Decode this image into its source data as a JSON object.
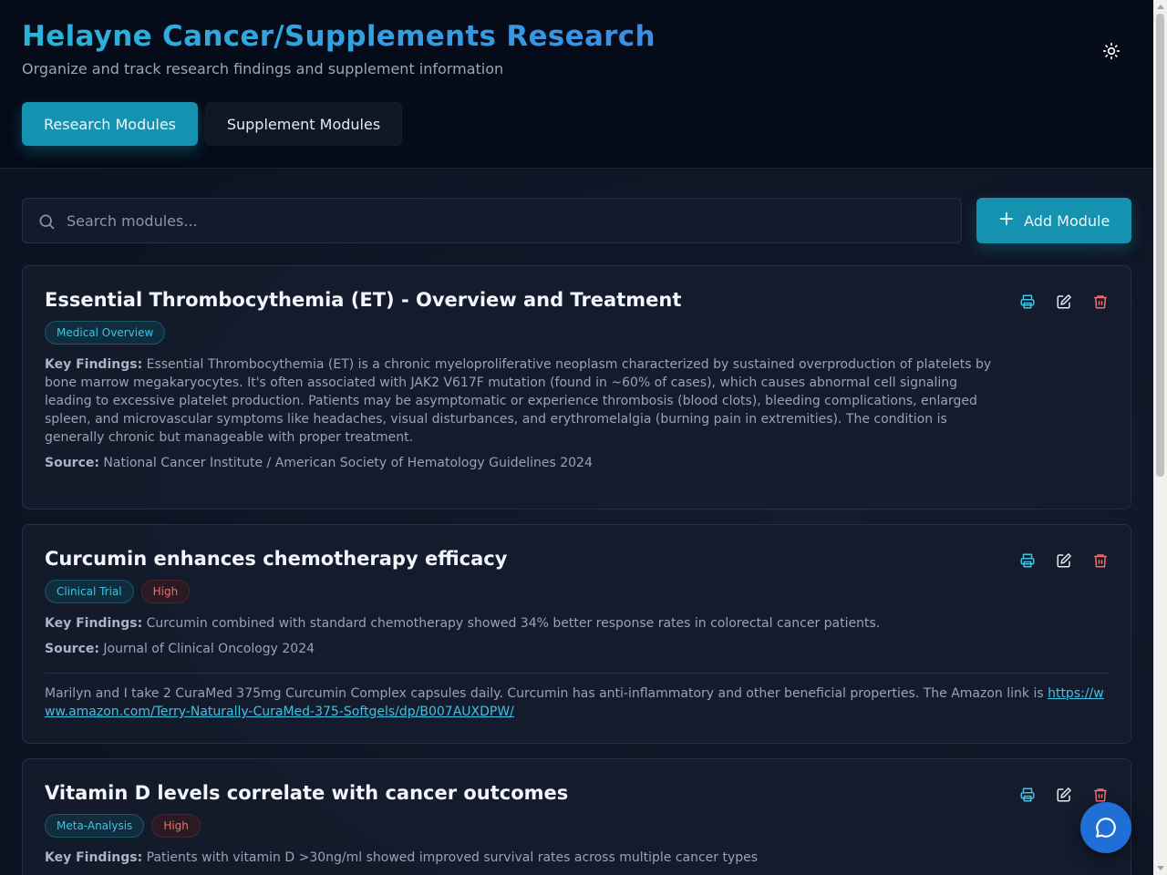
{
  "header": {
    "title": "Helayne Cancer/Supplements Research",
    "subtitle": "Organize and track research findings and supplement information",
    "theme_toggle_icon": "sun-icon"
  },
  "tabs": [
    {
      "label": "Research Modules",
      "active": true
    },
    {
      "label": "Supplement Modules",
      "active": false
    }
  ],
  "search": {
    "placeholder": "Search modules...",
    "value": ""
  },
  "add_button": {
    "label": "Add Module",
    "icon": "plus-icon"
  },
  "labels": {
    "key_findings": "Key Findings:",
    "source": "Source:"
  },
  "modules": [
    {
      "title": "Essential Thrombocythemia (ET) - Overview and Treatment",
      "category": "Medical Overview",
      "priority": null,
      "key_findings": "Essential Thrombocythemia (ET) is a chronic myeloproliferative neoplasm characterized by sustained overproduction of platelets by bone marrow megakaryocytes. It's often associated with JAK2 V617F mutation (found in ~60% of cases), which causes abnormal cell signaling leading to excessive platelet production. Patients may be asymptomatic or experience thrombosis (blood clots), bleeding complications, enlarged spleen, and microvascular symptoms like headaches, visual disturbances, and erythromelalgia (burning pain in extremities). The condition is generally chronic but manageable with proper treatment.",
      "source": "National Cancer Institute / American Society of Hematology Guidelines 2024"
    },
    {
      "title": "Curcumin enhances chemotherapy efficacy",
      "category": "Clinical Trial",
      "priority": "High",
      "key_findings": "Curcumin combined with standard chemotherapy showed 34% better response rates in colorectal cancer patients.",
      "source": "Journal of Clinical Oncology 2024",
      "note_text": "Marilyn and I take 2 CuraMed 375mg Curcumin Complex capsules daily. Curcumin has anti-inflammatory and other beneficial properties. The Amazon link is ",
      "note_link": "https://www.amazon.com/Terry-Naturally-CuraMed-375-Softgels/dp/B007AUXDPW/"
    },
    {
      "title": "Vitamin D levels correlate with cancer outcomes",
      "category": "Meta-Analysis",
      "priority": "High",
      "key_findings": "Patients with vitamin D >30ng/ml showed improved survival rates across multiple cancer types"
    }
  ],
  "card_actions": [
    "printer-icon",
    "edit-icon",
    "trash-icon"
  ],
  "chat_button": {
    "icon": "chat-bubble-icon"
  },
  "colors": {
    "accent": "#1592b0",
    "title_gradient_start": "#2ab4d8",
    "title_gradient_end": "#3a8fe6",
    "danger": "#f26d6d",
    "chat": "#1f6fd6"
  }
}
